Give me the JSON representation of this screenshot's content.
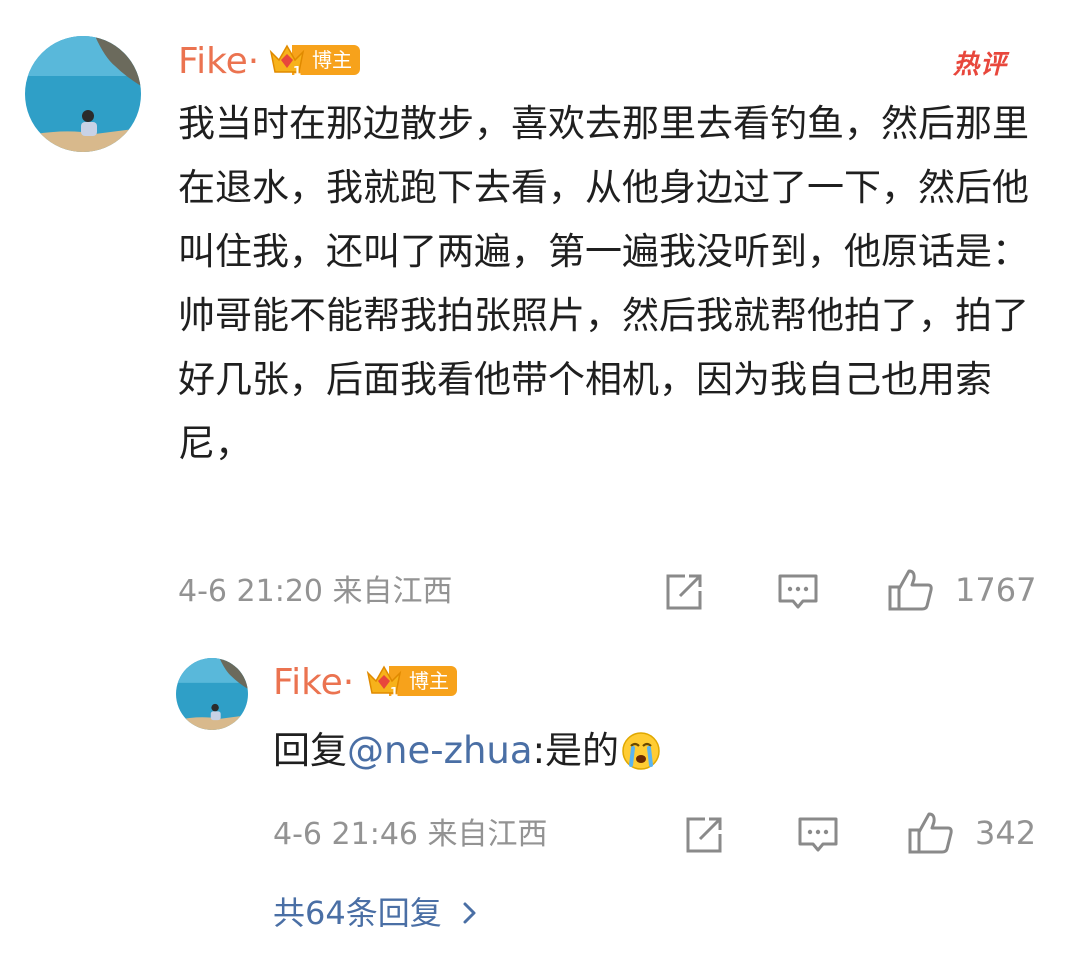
{
  "comment": {
    "author": "Fike·",
    "badge": "博主",
    "hot_label": "热评",
    "text": "我当时在那边散步，喜欢去那里去看钓鱼，然后那里在退水，我就跑下去看，从他身边过了一下，然后他叫住我，还叫了两遍，第一遍我没听到，他原话是：帅哥能不能帮我拍张照片，然后我就帮他拍了，拍了好几张，后面我看他带个相机，因为我自己也用索尼，",
    "time": "4-6 21:20",
    "source": "来自江西",
    "likes": "1767"
  },
  "reply": {
    "author": "Fike·",
    "badge": "博主",
    "prefix": "回复",
    "mention": "@ne-zhua",
    "text": ":是的",
    "time": "4-6 21:46",
    "source": "来自江西",
    "likes": "342"
  },
  "more_replies": "共64条回复",
  "colors": {
    "name": "#eb7350",
    "badge": "#f7a21b",
    "hot": "#e8473c",
    "link": "#4a6fa5",
    "meta": "#939393"
  }
}
